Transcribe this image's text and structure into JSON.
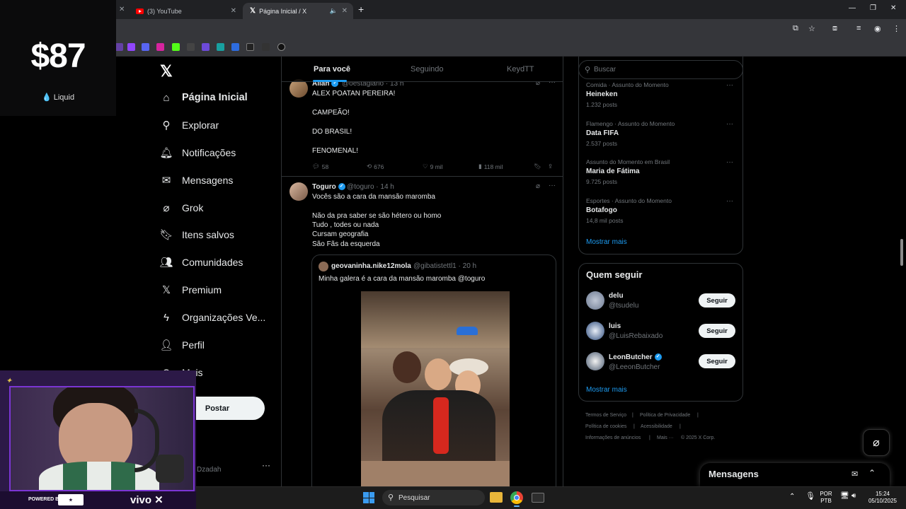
{
  "browser": {
    "tabs": [
      {
        "label": "(3) YouTube"
      },
      {
        "label": "Página Inicial / X"
      }
    ],
    "new_tab_symbol": "+"
  },
  "overlay": {
    "price": "$87",
    "brand": "Liquid"
  },
  "x": {
    "nav": [
      {
        "label": "Página Inicial",
        "icon": "home-icon"
      },
      {
        "label": "Explorar",
        "icon": "search-icon"
      },
      {
        "label": "Notificações",
        "icon": "bell-icon"
      },
      {
        "label": "Mensagens",
        "icon": "mail-icon"
      },
      {
        "label": "Grok",
        "icon": "grok-icon"
      },
      {
        "label": "Itens salvos",
        "icon": "bookmark-icon"
      },
      {
        "label": "Comunidades",
        "icon": "people-icon"
      },
      {
        "label": "Premium",
        "icon": "x-logo-icon"
      },
      {
        "label": "Organizações Ve...",
        "icon": "lightning-icon"
      },
      {
        "label": "Perfil",
        "icon": "person-icon"
      },
      {
        "label": "Mais",
        "icon": "more-icon"
      }
    ],
    "post_button": "Postar",
    "account_handle_partial": "Dzadah",
    "feed_tabs": [
      "Para você",
      "Seguindo",
      "KeydTT"
    ],
    "tweets": [
      {
        "name": "Allan",
        "handle": "@oestagiario",
        "time": "13 h",
        "lines": [
          "ALEX POATAN PEREIRA!",
          "CAMPEÃO!",
          "DO BRASIL!",
          "FENOMENAL!"
        ],
        "replies": "58",
        "retweets": "676",
        "likes": "9 mil",
        "views": "118 mil"
      },
      {
        "name": "Toguro",
        "handle": "@toguro",
        "time": "14 h",
        "lines": [
          "Vocês são a cara da mansão maromba",
          "Não da pra saber se são hétero ou homo",
          "Tudo , todes ou nada",
          "Cursam geografia",
          "São Fãs da esquerda"
        ],
        "quote": {
          "name": "geovaninha.nike12mola",
          "handle": "@gibatistettl1",
          "time": "20 h",
          "text": "Minha galera é a cara da mansão maromba @toguro"
        }
      }
    ],
    "search_placeholder": "Buscar",
    "trends": [
      {
        "category": "Comida · Assunto do Momento",
        "title": "Heineken",
        "posts": "1.232 posts"
      },
      {
        "category": "Flamengo · Assunto do Momento",
        "title": "Data FIFA",
        "posts": "2.537 posts"
      },
      {
        "category": "Assunto do Momento em Brasil",
        "title": "Maria de Fátima",
        "posts": "9.725 posts"
      },
      {
        "category": "Esportes · Assunto do Momento",
        "title": "Botafogo",
        "posts": "14,8 mil posts"
      }
    ],
    "show_more": "Mostrar mais",
    "who_to_follow_title": "Quem seguir",
    "who_to_follow": [
      {
        "name": "delu",
        "handle": "@tsudelu"
      },
      {
        "name": "luis",
        "handle": "@LuisRebaixado"
      },
      {
        "name": "LeonButcher",
        "handle": "@LeeonButcher"
      }
    ],
    "follow_label": "Seguir",
    "footer_links": [
      "Termos de Serviço",
      "Política de Privacidade",
      "Política de cookies",
      "Acessibilidade",
      "Informações de anúncios",
      "Mais ···",
      "© 2025 X Corp."
    ],
    "messages_drawer": "Mensagens"
  },
  "stream_overlay": {
    "powered_by": "POWERED BY",
    "sponsor": "vivo"
  },
  "taskbar": {
    "search_label": "Pesquisar",
    "lang_line1": "POR",
    "lang_line2": "PTB",
    "time": "15:24",
    "date": "05/10/2025"
  },
  "colors": {
    "accent": "#1d9bf0",
    "stream_purple": "#7b35d4"
  }
}
